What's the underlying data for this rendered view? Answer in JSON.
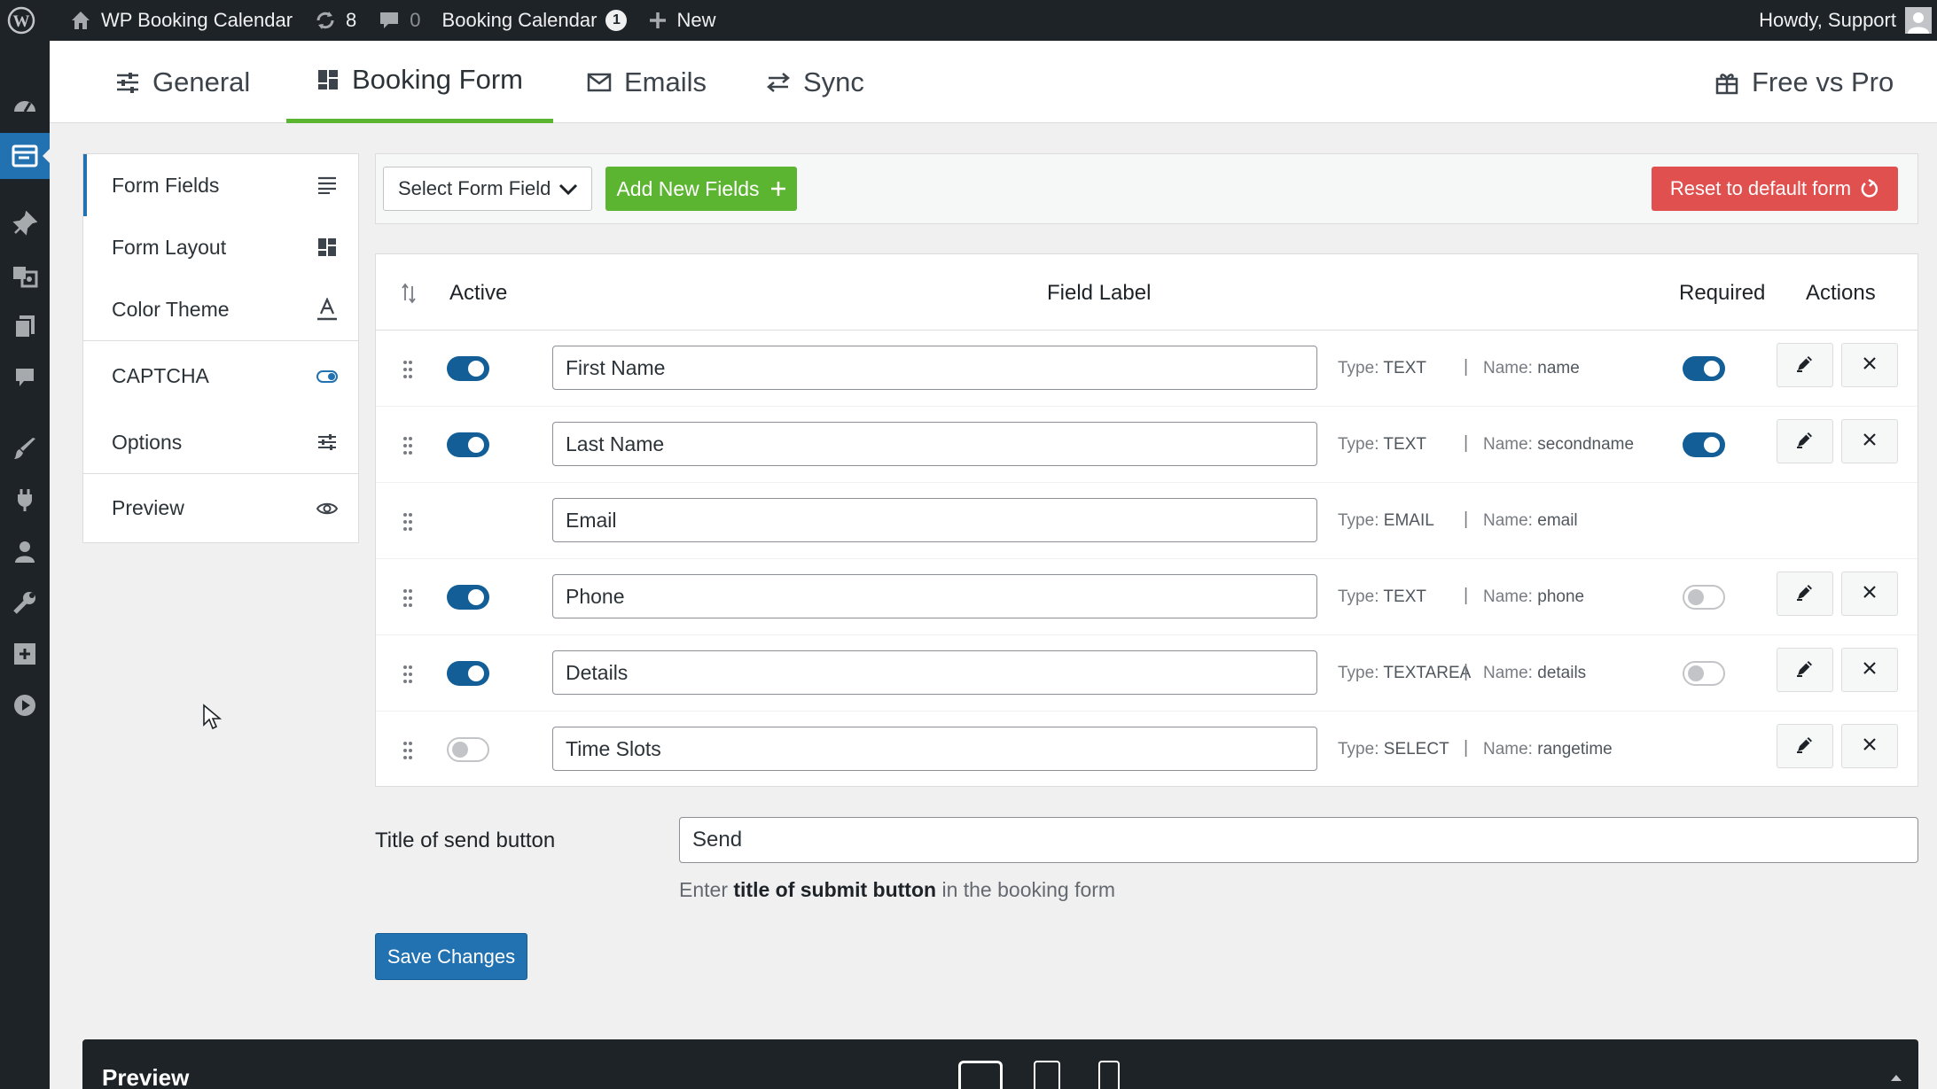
{
  "adminbar": {
    "site_name": "WP Booking Calendar",
    "updates_count": "8",
    "comments_count": "0",
    "plugin_menu": "Booking Calendar",
    "plugin_badge": "1",
    "new_label": "New",
    "howdy": "Howdy, Support"
  },
  "tabs": [
    {
      "label": "General",
      "icon": "sliders-icon"
    },
    {
      "label": "Booking Form",
      "icon": "grid-icon"
    },
    {
      "label": "Emails",
      "icon": "envelope-icon"
    },
    {
      "label": "Sync",
      "icon": "arrows-icon"
    },
    {
      "label": "Free vs Pro",
      "icon": "gift-icon"
    }
  ],
  "leftnav": [
    {
      "label": "Form Fields",
      "icon": "lines-icon"
    },
    {
      "label": "Form Layout",
      "icon": "layout-icon"
    },
    {
      "label": "Color Theme",
      "icon": "font-color-icon"
    },
    {
      "label": "CAPTCHA",
      "icon": "toggle-icon"
    },
    {
      "label": "Options",
      "icon": "sliders-icon"
    },
    {
      "label": "Preview",
      "icon": "eye-icon"
    }
  ],
  "toolbar": {
    "select_field": "Select Form Field",
    "add_new": "Add New Fields",
    "reset": "Reset to default form"
  },
  "table": {
    "headers": {
      "active": "Active",
      "label": "Field Label",
      "required": "Required",
      "actions": "Actions"
    },
    "type_prefix": "Type:",
    "name_prefix": "Name:",
    "rows": [
      {
        "label": "First Name",
        "type": "TEXT",
        "name": "name",
        "active": true,
        "required": true
      },
      {
        "label": "Last Name",
        "type": "TEXT",
        "name": "secondname",
        "active": true,
        "required": true
      },
      {
        "label": "Email",
        "type": "EMAIL",
        "name": "email",
        "active": null,
        "required": null
      },
      {
        "label": "Phone",
        "type": "TEXT",
        "name": "phone",
        "active": true,
        "required": false
      },
      {
        "label": "Details",
        "type": "TEXTAREA",
        "name": "details",
        "active": true,
        "required": false
      },
      {
        "label": "Time Slots",
        "type": "SELECT",
        "name": "rangetime",
        "active": false,
        "required": null
      }
    ]
  },
  "send_button": {
    "label": "Title of send button",
    "value": "Send",
    "hint_pre": "Enter ",
    "hint_bold": "title of submit button",
    "hint_post": " in the booking form"
  },
  "save_label": "Save Changes",
  "preview": {
    "title": "Preview"
  },
  "colors": {
    "primary": "#2271b1",
    "green": "#5cb531",
    "red": "#e0504f",
    "dark": "#1d2327"
  }
}
